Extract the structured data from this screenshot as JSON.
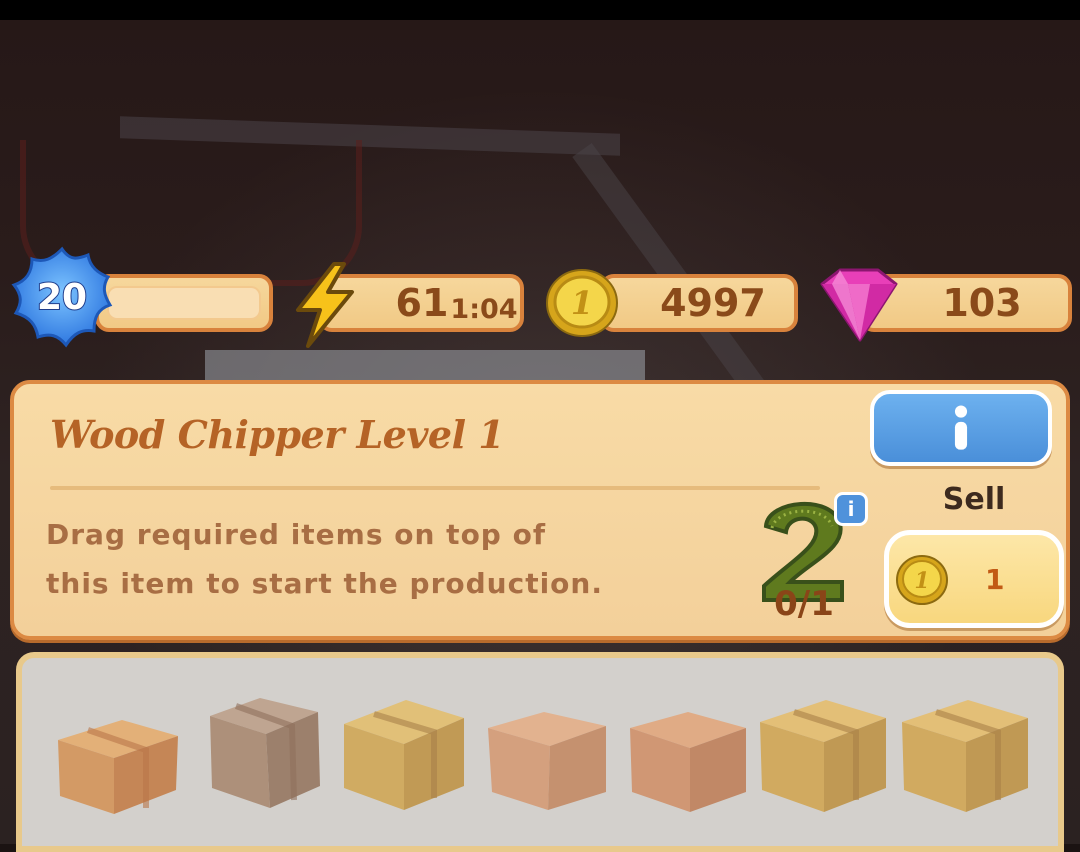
{
  "hud": {
    "level": "20",
    "energy": "61",
    "energy_timer": "1:04",
    "coins": "4997",
    "gems": "103"
  },
  "panel": {
    "title": "Wood Chipper Level 1",
    "description": "Drag required items on top of this item to start the production.",
    "requirement_progress": "0/1",
    "info_button_icon": "info-icon",
    "sell_label": "Sell",
    "sell_price": "1"
  },
  "board": {
    "items": [
      "cardboard-box",
      "cardboard-box",
      "cardboard-box",
      "cardboard-box",
      "cardboard-box",
      "cardboard-box",
      "cardboard-box"
    ]
  },
  "colors": {
    "pill_fill": "#f3cd8c",
    "pill_border": "#d8823c",
    "hud_text": "#8a4a1a",
    "title": "#b56326",
    "info_blue": "#4a8fd9",
    "sell_fill": "#f8d77e"
  }
}
